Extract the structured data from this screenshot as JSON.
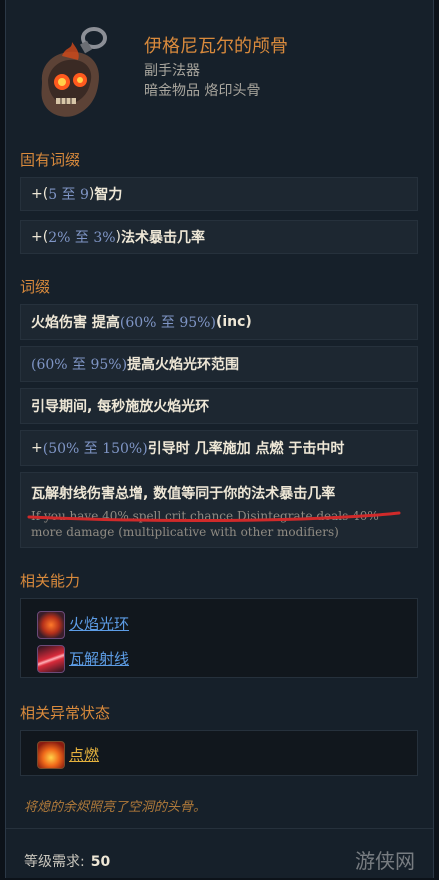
{
  "item": {
    "title": "伊格尼瓦尔的颅骨",
    "type": "副手法器",
    "subtype": "暗金物品 烙印头骨"
  },
  "implicit": {
    "title": "固有词缀",
    "rows": [
      {
        "prefix": "+(",
        "num": "5 至 9",
        "suffix": ") ",
        "text": "智力"
      },
      {
        "prefix": "+(",
        "num": "2% 至 3%",
        "suffix": ") ",
        "text": "法术暴击几率"
      }
    ]
  },
  "affixes": {
    "title": "词缀",
    "r1_text": "火焰伤害 提高 ",
    "r1_num": "(60% 至 95%)",
    "r1_tail": " (inc)",
    "r2_num": "(60% 至 95%)",
    "r2_text": " 提高火焰光环范围",
    "r3_text": "引导期间, 每秒施放火焰光环",
    "r4_prefix": "+",
    "r4_num": "(50% 至 150%)",
    "r4_text": " 引导时 几率施加 点燃 于击中时",
    "r5_text": "瓦解射线伤害总增, 数值等同于你的法术暴击几率",
    "r5_sub1": "If you have 40% spell crit chance Disintegrate deals 40%",
    "r5_sub2": "more damage (multiplicative with other modifiers)"
  },
  "abilities": {
    "title": "相关能力",
    "items": [
      "火焰光环",
      "瓦解射线"
    ]
  },
  "ailments": {
    "title": "相关异常状态",
    "items": [
      "点燃"
    ]
  },
  "flavor": "将熄的余烬照亮了空洞的头骨。",
  "requirement": {
    "label": "等级需求:",
    "value": "50"
  },
  "watermark": "游侠网",
  "colors": {
    "accent": "#d98a3c",
    "number": "#7f95c5",
    "link": "#5d9de6",
    "ailment_link": "#e3b13e",
    "underline_mark": "#d02a2a"
  }
}
